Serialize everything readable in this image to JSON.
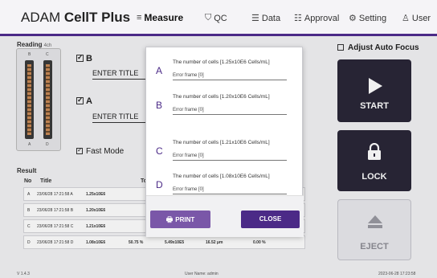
{
  "app": {
    "name_regular": "ADAM ",
    "name_bold": "CellT Plus"
  },
  "nav": [
    {
      "label": "Measure",
      "icon": "menu-icon",
      "active": true
    },
    {
      "label": "QC",
      "icon": "shield-icon",
      "active": false
    },
    {
      "label": "Data",
      "icon": "list-icon",
      "active": false
    },
    {
      "label": "Approval",
      "icon": "approval-list-icon",
      "active": false
    },
    {
      "label": "Setting",
      "icon": "gear-icon",
      "active": false
    },
    {
      "label": "User",
      "icon": "user-icon",
      "active": false
    }
  ],
  "reading": {
    "label": "Reading",
    "sub": "4ch",
    "lane_letters": [
      "B",
      "C",
      "A",
      "D"
    ],
    "channel_b": {
      "letter": "B",
      "title": "ENTER TITLE"
    },
    "channel_a": {
      "letter": "A",
      "title": "ENTER TITLE"
    },
    "fast_mode": "Fast Mode"
  },
  "result": {
    "label": "Result",
    "headers": {
      "no": "No",
      "title": "Title",
      "total": "Tot"
    },
    "rows": [
      {
        "no": "A",
        "date": "23/06/28 17:21:58 A",
        "value": "1.25x10E6",
        "p": "",
        "c": "",
        "s": "",
        "z": ""
      },
      {
        "no": "B",
        "date": "23/06/28 17:21:58 B",
        "value": "1.20x10E6",
        "p": "",
        "c": "",
        "s": "",
        "z": ""
      },
      {
        "no": "C",
        "date": "23/06/28 17:21:58 C",
        "value": "1.21x10E6",
        "p": "",
        "c": "",
        "s": "",
        "z": ""
      },
      {
        "no": "D",
        "date": "23/06/28 17:21:58 D",
        "value": "1.08x10E6",
        "p": "50.75 %",
        "c": "5.49x10E5",
        "s": "16.52 μm",
        "z": "0.00 %"
      }
    ]
  },
  "side": {
    "adjust": "Adjust Auto Focus",
    "start": "START",
    "lock": "LOCK",
    "eject": "EJECT"
  },
  "footer": {
    "version": "V 1.4.3",
    "user": "User Name: admin",
    "datetime": "2023-06-28 17:23:58"
  },
  "dialog": {
    "entries": [
      {
        "letter": "A",
        "number": "The number of cells [1.25x10E6 Cells/mL]",
        "error": "Error frame [0]"
      },
      {
        "letter": "B",
        "number": "The number of cells [1.20x10E6 Cells/mL]",
        "error": "Error frame [0]"
      },
      {
        "letter": "C",
        "number": "The number of cells [1.21x10E6 Cells/mL]",
        "error": "Error frame [0]"
      },
      {
        "letter": "D",
        "number": "The number of cells [1.08x10E6 Cells/mL]",
        "error": "Error frame [0]"
      }
    ],
    "print": "PRINT",
    "close": "CLOSE"
  },
  "colors": {
    "accent": "#4b2a87",
    "dark_button": "#2a2738",
    "print": "#7a57a8"
  }
}
